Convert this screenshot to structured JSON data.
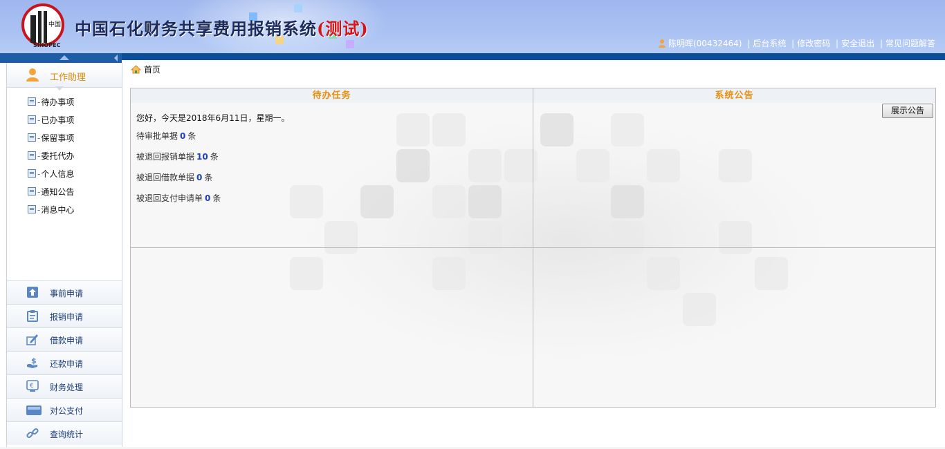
{
  "header": {
    "title_main": "中国石化财务共享费用报销系统",
    "title_test": "(测试)",
    "logo_text": "SINOPEC",
    "logo_cn": "中国石化",
    "user": "陈明晖(00432464)",
    "links": [
      "后台系统",
      "修改密码",
      "安全退出",
      "常见问题解答"
    ]
  },
  "sidebar": {
    "section_title": "工作助理",
    "sub_items": [
      "待办事项",
      "已办事项",
      "保留事项",
      "委托代办",
      "个人信息",
      "通知公告",
      "消息中心"
    ],
    "menu": [
      {
        "label": "事前申请",
        "icon": "upload-arrow-icon"
      },
      {
        "label": "报销申请",
        "icon": "clipboard-icon"
      },
      {
        "label": "借款申请",
        "icon": "pen-edit-icon"
      },
      {
        "label": "还款申请",
        "icon": "money-hand-icon"
      },
      {
        "label": "财务处理",
        "icon": "euro-monitor-icon"
      },
      {
        "label": "对公支付",
        "icon": "wallet-card-icon"
      },
      {
        "label": "查询统计",
        "icon": "link-chain-icon"
      }
    ]
  },
  "breadcrumb": {
    "home": "首页"
  },
  "tasks_panel": {
    "title": "待办任务",
    "greeting": "您好，今天是2018年6月11日，星期一。",
    "rows": [
      {
        "label": "待审批单据",
        "count": "0",
        "unit": "条"
      },
      {
        "label": "被退回报销单据",
        "count": "10",
        "unit": "条"
      },
      {
        "label": "被退回借款单据",
        "count": "0",
        "unit": "条"
      },
      {
        "label": "被退回支付申请单",
        "count": "0",
        "unit": "条"
      }
    ]
  },
  "notice_panel": {
    "title": "系统公告",
    "show_button": "展示公告"
  },
  "colors": {
    "header_bg": "#a9c1f2",
    "nav_blue": "#0c4d99",
    "accent_orange": "#e8900f",
    "count_blue": "#1f3fbf",
    "test_red": "#d4131a"
  }
}
